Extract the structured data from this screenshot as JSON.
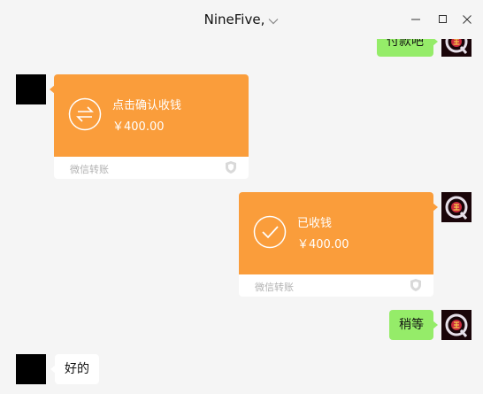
{
  "window": {
    "title": "NineFive,",
    "controls": {
      "minimize": "minimize-icon",
      "maximize": "maximize-icon",
      "close": "close-icon"
    }
  },
  "messages": [
    {
      "side": "right",
      "type": "text",
      "text": "付款吧"
    },
    {
      "side": "left",
      "type": "transfer",
      "status": "点击确认收钱",
      "amount": "￥400.00",
      "footer": "微信转账"
    },
    {
      "side": "right",
      "type": "transfer",
      "status": "已收钱",
      "amount": "￥400.00",
      "footer": "微信转账"
    },
    {
      "side": "right",
      "type": "text",
      "text": "稍等"
    },
    {
      "side": "left",
      "type": "text",
      "text": "好的"
    }
  ],
  "colors": {
    "background": "#f5f5f5",
    "self_bubble": "#95ec69",
    "other_bubble": "#ffffff",
    "transfer": "#fa9d3b",
    "footer_text": "#b2b2b2"
  }
}
